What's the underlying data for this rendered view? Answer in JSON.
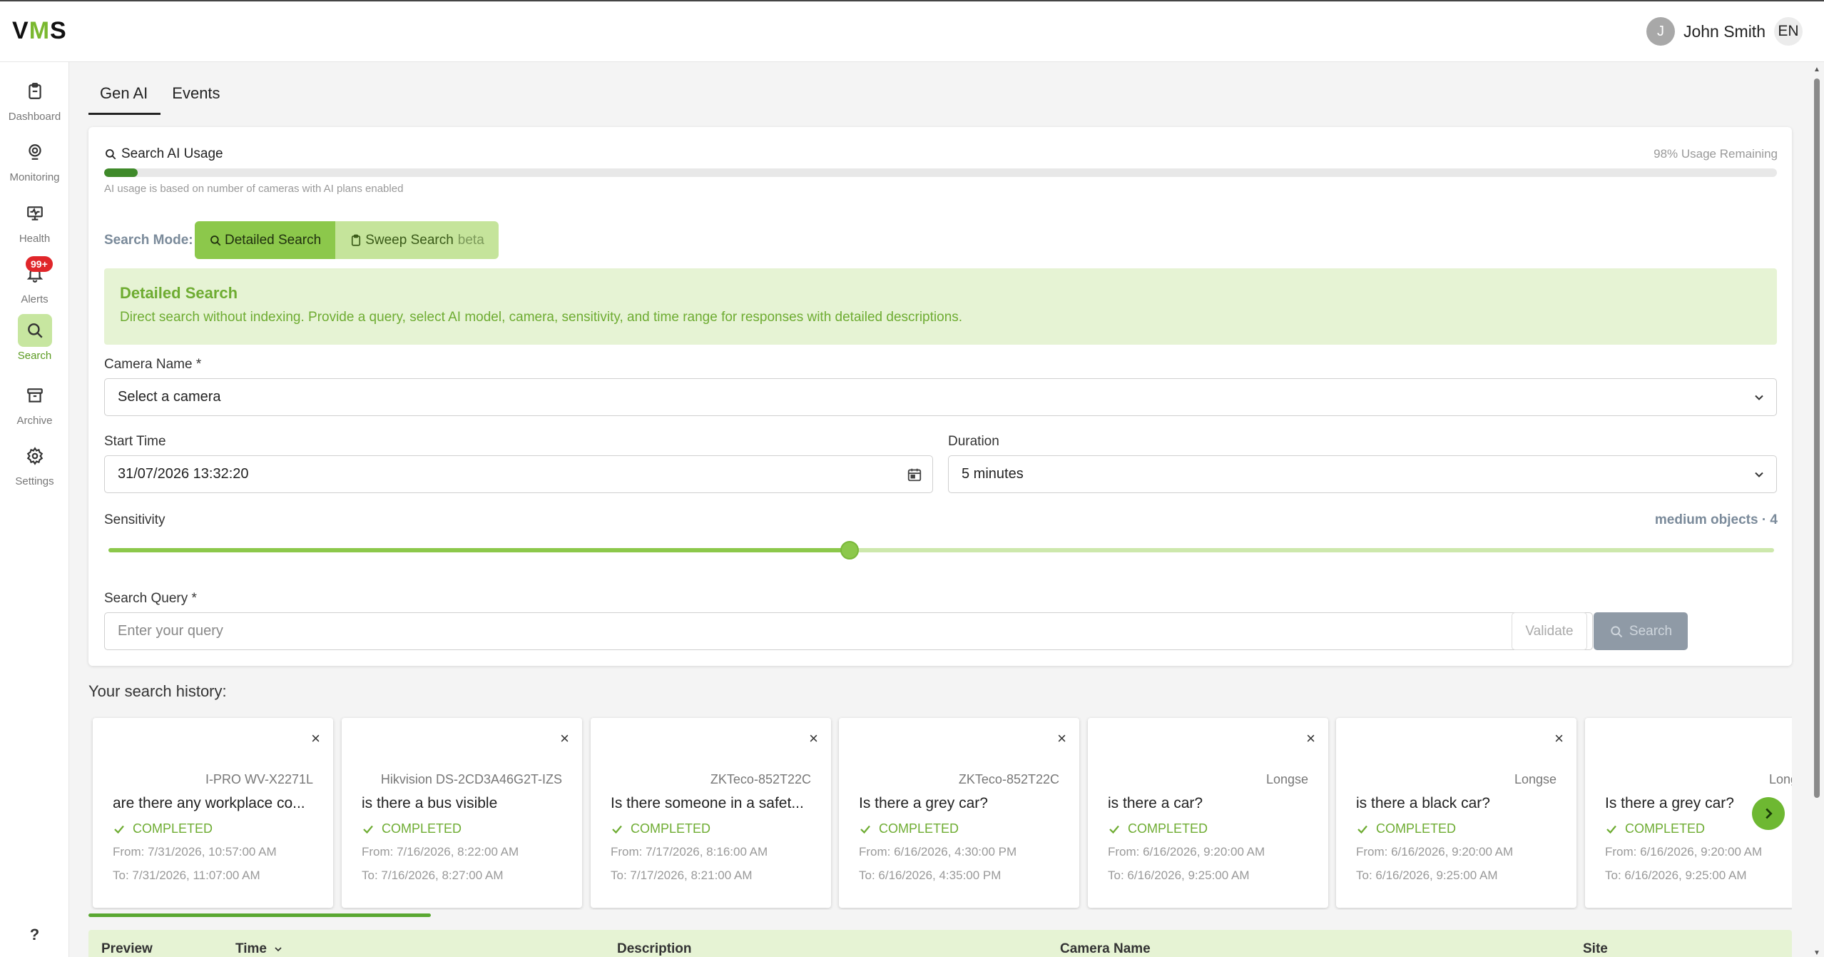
{
  "header": {
    "logo": {
      "v": "V",
      "m": "M",
      "s": "S"
    },
    "user_initial": "J",
    "user_name": "John Smith",
    "language": "EN"
  },
  "sidebar": {
    "items": [
      {
        "label": "Dashboard",
        "icon": "clipboard-icon"
      },
      {
        "label": "Monitoring",
        "icon": "webcam-icon"
      },
      {
        "label": "Health",
        "icon": "monitor-health-icon"
      },
      {
        "label": "Alerts",
        "icon": "bell-icon",
        "badge": "99+"
      },
      {
        "label": "Search",
        "icon": "search-icon",
        "active": true
      },
      {
        "label": "Archive",
        "icon": "archive-box-icon"
      },
      {
        "label": "Settings",
        "icon": "gear-icon"
      }
    ],
    "help": "?"
  },
  "tabs": [
    {
      "label": "Gen AI",
      "active": true
    },
    {
      "label": "Events",
      "active": false
    }
  ],
  "usage": {
    "title": "Search AI Usage",
    "remaining": "98% Usage Remaining",
    "used_fraction": 0.02,
    "note": "AI usage is based on number of cameras with AI plans enabled"
  },
  "mode": {
    "label": "Search Mode:",
    "detailed": "Detailed Search",
    "sweep": "Sweep Search",
    "beta": "beta"
  },
  "info": {
    "title": "Detailed Search",
    "description": "Direct search without indexing. Provide a query, select AI model, camera, sensitivity, and time range for responses with detailed descriptions."
  },
  "form": {
    "camera_label": "Camera Name",
    "camera_placeholder": "Select a camera",
    "start_label": "Start Time",
    "start_value": "31/07/2026 13:32:20",
    "duration_label": "Duration",
    "duration_value": "5 minutes",
    "sensitivity_label": "Sensitivity",
    "sensitivity_value": "medium objects · 4",
    "sensitivity_fraction": 0.445,
    "query_label": "Search Query",
    "query_placeholder": "Enter your query",
    "required_mark": "*",
    "validate": "Validate",
    "search": "Search"
  },
  "history": {
    "title": "Your search history:",
    "cards": [
      {
        "camera": "I-PRO WV-X2271L",
        "query": "are there any workplace co...",
        "status": "COMPLETED",
        "from": "From: 7/31/2026, 10:57:00 AM",
        "to": "To: 7/31/2026, 11:07:00 AM"
      },
      {
        "camera": "Hikvision DS-2CD3A46G2T-IZS",
        "query": "is there a bus visible",
        "status": "COMPLETED",
        "from": "From: 7/16/2026, 8:22:00 AM",
        "to": "To: 7/16/2026, 8:27:00 AM"
      },
      {
        "camera": "ZKTeco-852T22C",
        "query": "Is there someone in a safet...",
        "status": "COMPLETED",
        "from": "From: 7/17/2026, 8:16:00 AM",
        "to": "To: 7/17/2026, 8:21:00 AM"
      },
      {
        "camera": "ZKTeco-852T22C",
        "query": "Is there a grey car?",
        "status": "COMPLETED",
        "from": "From: 6/16/2026, 4:30:00 PM",
        "to": "To: 6/16/2026, 4:35:00 PM"
      },
      {
        "camera": "Longse",
        "query": "is there a car?",
        "status": "COMPLETED",
        "from": "From: 6/16/2026, 9:20:00 AM",
        "to": "To: 6/16/2026, 9:25:00 AM"
      },
      {
        "camera": "Longse",
        "query": "is there a black car?",
        "status": "COMPLETED",
        "from": "From: 6/16/2026, 9:20:00 AM",
        "to": "To: 6/16/2026, 9:25:00 AM"
      },
      {
        "camera": "Longse",
        "query": "Is there a grey car?",
        "status": "COMPLETED",
        "from": "From: 6/16/2026, 9:20:00 AM",
        "to": "To: 6/16/2026, 9:25:00 AM"
      }
    ],
    "close": "×"
  },
  "table": {
    "columns": [
      "Preview",
      "Time",
      "Description",
      "Camera Name",
      "Site"
    ]
  },
  "colors": {
    "accent": "#8cc84b",
    "accent_text": "#6eac32",
    "usage_fill": "#3f8a2a",
    "info_bg": "#e6f3d4",
    "alert_badge": "#e0262a"
  }
}
